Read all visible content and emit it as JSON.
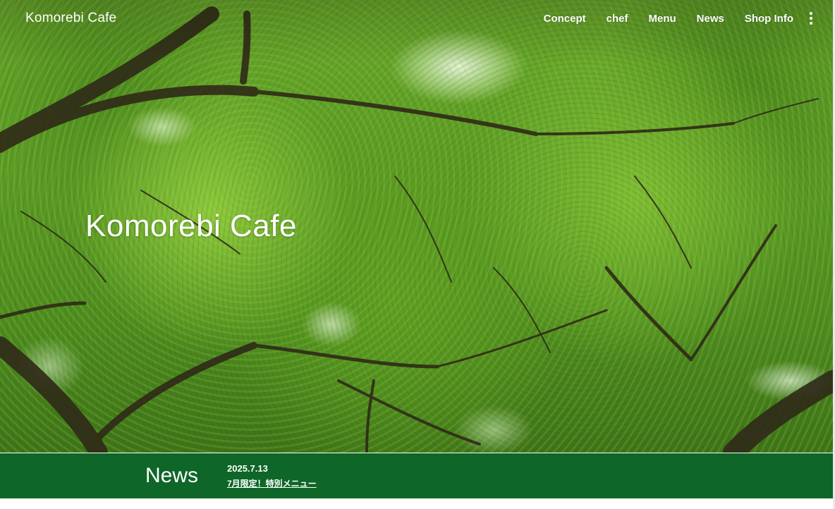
{
  "header": {
    "site_title": "Komorebi Cafe",
    "nav": [
      {
        "label": "Concept"
      },
      {
        "label": "chef"
      },
      {
        "label": "Menu"
      },
      {
        "label": "News"
      },
      {
        "label": "Shop Info"
      }
    ],
    "more_icon": "vertical-dots-icon"
  },
  "hero": {
    "title": "Komorebi Cafe",
    "image": "forest-canopy-photo"
  },
  "news": {
    "heading": "News",
    "items": [
      {
        "date": "2025.7.13",
        "title": "7月限定！特別メニュー"
      }
    ]
  },
  "colors": {
    "news_bar": "#0e6628",
    "text": "#ffffff"
  }
}
